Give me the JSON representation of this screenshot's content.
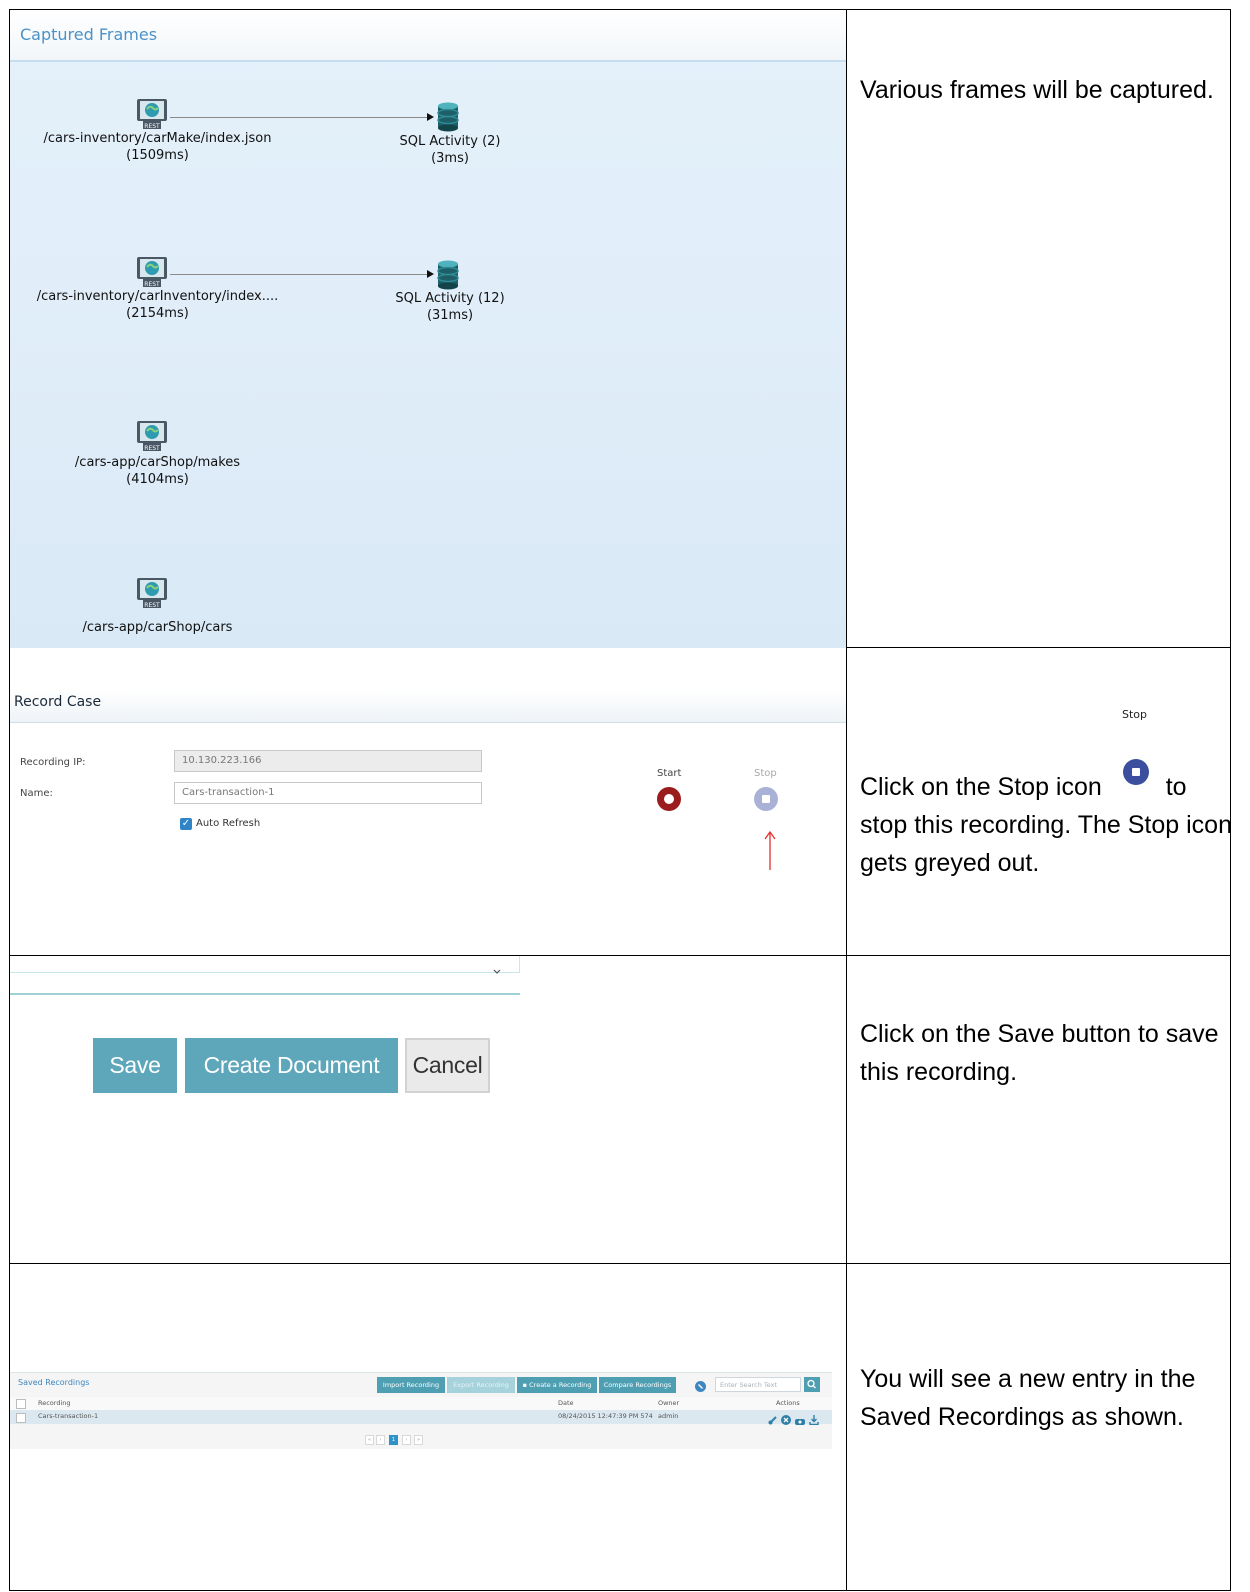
{
  "captured_frames": {
    "title": "Captured Frames",
    "nodes": [
      {
        "path": "/cars-inventory/carMake/index.json",
        "time": "(1509ms)",
        "icon": "rest-icon"
      },
      {
        "path": "SQL Activity (2)",
        "time": "(3ms)",
        "icon": "database-icon"
      },
      {
        "path": "/cars-inventory/carInventory/index....",
        "time": "(2154ms)",
        "icon": "rest-icon"
      },
      {
        "path": "SQL Activity (12)",
        "time": "(31ms)",
        "icon": "database-icon"
      },
      {
        "path": "/cars-app/carShop/makes",
        "time": "(4104ms)",
        "icon": "rest-icon"
      },
      {
        "path": "/cars-app/carShop/cars",
        "time": "",
        "icon": "rest-icon"
      }
    ],
    "icon_badge": "REST"
  },
  "record_case": {
    "title": "Record Case",
    "ip_label": "Recording IP:",
    "ip_value": "10.130.223.166",
    "name_label": "Name:",
    "name_value": "Cars-transaction-1",
    "auto_refresh_label": "Auto Refresh",
    "start_label": "Start",
    "stop_label": "Stop",
    "start_color": "#9b1c1c",
    "stop_color": "#a9b2d6",
    "arrow_color": "#e53030"
  },
  "buttons": {
    "save": "Save",
    "create_document": "Create Document",
    "cancel": "Cancel"
  },
  "saved_recordings": {
    "title": "Saved Recordings",
    "toolbar": {
      "import": "Import Recording",
      "export": "Export Recording",
      "create": "Create a Recording",
      "compare": "Compare Recordings",
      "search_placeholder": "Enter Search Text"
    },
    "columns": {
      "recording": "Recording",
      "date": "Date",
      "owner": "Owner",
      "actions": "Actions"
    },
    "rows": [
      {
        "recording": "Cars-transaction-1",
        "date": "08/24/2015 12:47:39 PM 574",
        "owner": "admin"
      }
    ],
    "pagination": [
      "«",
      "‹",
      "1",
      "›",
      "»"
    ]
  },
  "descriptions": {
    "row1": "Various frames will be captured.",
    "row2_a": "Click on the Stop icon",
    "row2_b": "to stop this recording. The Stop icon gets greyed out.",
    "row2_icon_label": "Stop",
    "row3": "Click on the Save button to save this recording.",
    "row4": "You will see a new entry in the Saved Recordings as shown."
  }
}
